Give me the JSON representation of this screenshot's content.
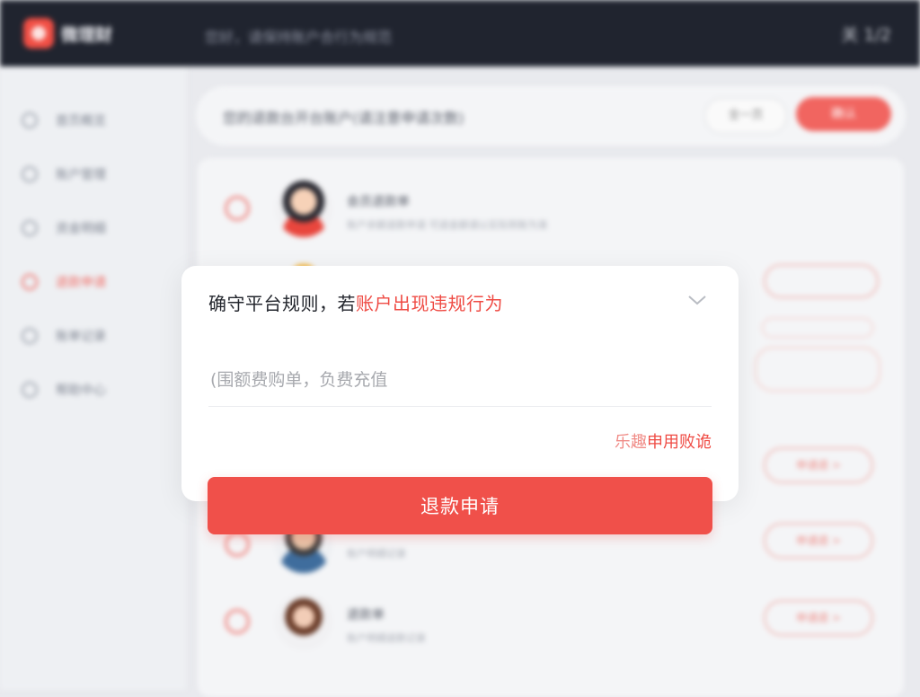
{
  "topbar": {
    "app_name": "微理财",
    "notice": "您好，请保持账户合行为规范",
    "right_text": "关 1/2"
  },
  "sidebar": {
    "items": [
      {
        "label": "首页概览",
        "icon": "home-icon",
        "active": false
      },
      {
        "label": "账户管理",
        "icon": "user-icon",
        "active": false
      },
      {
        "label": "资金明细",
        "icon": "list-icon",
        "active": false
      },
      {
        "label": "退款申请",
        "icon": "refund-icon",
        "active": true
      },
      {
        "label": "账单记录",
        "icon": "bill-icon",
        "active": false
      },
      {
        "label": "帮助中心",
        "icon": "help-icon",
        "active": false
      }
    ]
  },
  "list_header": {
    "title": "您的退款台开台账户(请注意申请次数)",
    "outline_button": "全一页",
    "red_button": "确认"
  },
  "rows": [
    {
      "name": "会员退款单",
      "desc": "账户余额退款申请 可退金额请以实际到账为准",
      "pill": ""
    },
    {
      "name": "",
      "desc": "",
      "pill": ""
    },
    {
      "name": "",
      "desc": "",
      "pill": ""
    },
    {
      "name": "",
      "desc": "",
      "pill": "申请退 >"
    },
    {
      "name": "",
      "desc": "账户明细记录",
      "pill": "申请退 >"
    },
    {
      "name": "退款单",
      "desc": "账户明细退款记录",
      "pill": "申请退 >"
    }
  ],
  "dialog": {
    "heading_prefix": "确守平台规则，若",
    "heading_highlight": "账户出现违规行为",
    "amount_placeholder": "(围额费购单，负费充值",
    "amount_value": "",
    "link_prefix": "乐趣",
    "link_text": "申用败诡"
  },
  "submit_label": "退款申请",
  "colors": {
    "accent": "#f0504a",
    "topbar": "#20242f",
    "highlight": "#ef4b44"
  }
}
